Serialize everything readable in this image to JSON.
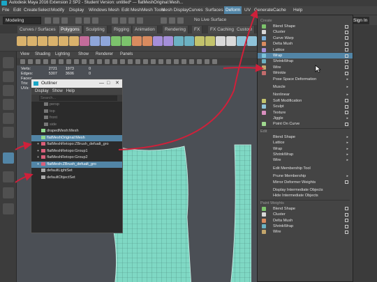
{
  "window": {
    "title": "Autodesk Maya 2016 Extension 2 SP2 - Student Version: untitled*   ---   flatMeshOriginal:Mesh..."
  },
  "menubar": [
    {
      "label": "File",
      "active": false
    },
    {
      "label": "Edit",
      "active": false
    },
    {
      "label": "Create",
      "active": false
    },
    {
      "label": "Select",
      "active": false
    },
    {
      "label": "Modify",
      "active": false
    },
    {
      "label": "Display",
      "active": false
    },
    {
      "label": "Windows",
      "active": false
    },
    {
      "label": "Mesh",
      "active": false
    },
    {
      "label": "Edit Mesh",
      "active": false
    },
    {
      "label": "Mesh Tools",
      "active": false
    },
    {
      "label": "Mesh Display",
      "active": false
    },
    {
      "label": "Curves",
      "active": false
    },
    {
      "label": "Surfaces",
      "active": false
    },
    {
      "label": "Deform",
      "active": true
    },
    {
      "label": "UV",
      "active": false
    },
    {
      "label": "Generate",
      "active": false
    },
    {
      "label": "Cache",
      "active": false
    },
    {
      "label": "Help",
      "active": false
    }
  ],
  "statusline": {
    "mode": "Modeling",
    "live_surface": "No Live Surface",
    "sign_in": "Sign In"
  },
  "shelf_tabs": [
    {
      "label": "Curves / Surfaces",
      "active": false
    },
    {
      "label": "Polygons",
      "active": true
    },
    {
      "label": "Sculpting",
      "active": false
    },
    {
      "label": "Rigging",
      "active": false
    },
    {
      "label": "Animation",
      "active": false
    },
    {
      "label": "Rendering",
      "active": false
    },
    {
      "label": "FX",
      "active": false
    },
    {
      "label": "FX Caching",
      "active": false
    },
    {
      "label": "Custom",
      "active": false
    }
  ],
  "viewport": {
    "menus": [
      "View",
      "Shading",
      "Lighting",
      "Show",
      "Renderer",
      "Panels"
    ],
    "hud": [
      {
        "label": "Verts:",
        "v1": "2721",
        "v2": "1973",
        "v3": "0"
      },
      {
        "label": "Edges:",
        "v1": "5307",
        "v2": "3606",
        "v3": "0"
      },
      {
        "label": "Faces:",
        "v1": "",
        "v2": "",
        "v3": ""
      },
      {
        "label": "Tris:",
        "v1": "",
        "v2": "",
        "v3": ""
      },
      {
        "label": "UVs:",
        "v1": "",
        "v2": "",
        "v3": ""
      }
    ]
  },
  "outliner": {
    "title": "Outliner",
    "menus": [
      "Display",
      "Show",
      "Help"
    ],
    "search_placeholder": "Search...",
    "items": [
      {
        "label": "persp",
        "state": "dim",
        "icon": "camera-icon",
        "expander": ""
      },
      {
        "label": "top",
        "state": "dim",
        "icon": "camera-icon",
        "expander": ""
      },
      {
        "label": "front",
        "state": "dim",
        "icon": "camera-icon",
        "expander": ""
      },
      {
        "label": "side",
        "state": "dim",
        "icon": "camera-icon",
        "expander": ""
      },
      {
        "label": "drapedMesh:Mesh",
        "state": "normal",
        "icon": "mesh-icon",
        "expander": ""
      },
      {
        "label": "flatMeshOriginal:Mesh",
        "state": "selected",
        "icon": "mesh-icon",
        "expander": ""
      },
      {
        "label": "flatMeshRetopo:ZBrush_defualt_gro",
        "state": "normal",
        "icon": "group-icon",
        "expander": "+"
      },
      {
        "label": "flatMeshRetopo:Group1",
        "state": "normal",
        "icon": "group-icon",
        "expander": "+"
      },
      {
        "label": "flatMeshRetopo:Group2",
        "state": "normal",
        "icon": "group-icon",
        "expander": "+"
      },
      {
        "label": "flatMesh:ZBrush_defualt_gro",
        "state": "selected",
        "icon": "group-icon",
        "expander": "+"
      },
      {
        "label": "defaultLightSet",
        "state": "normal",
        "icon": "set-icon",
        "expander": ""
      },
      {
        "label": "defaultObjectSet",
        "state": "normal",
        "icon": "set-icon",
        "expander": ""
      }
    ]
  },
  "deform_menu": {
    "sections": [
      {
        "title": "Create",
        "items": [
          {
            "label": "Blend Shape",
            "icon": "blend-shape-icon",
            "color": "#7cc36c",
            "trail": "opt",
            "hl": false
          },
          {
            "label": "Cluster",
            "icon": "cluster-icon",
            "color": "#d9d9d9",
            "trail": "opt",
            "hl": false
          },
          {
            "label": "Curve Warp",
            "icon": "curve-warp-icon",
            "color": "#7bb0d9",
            "trail": "opt",
            "hl": false
          },
          {
            "label": "Delta Mush",
            "icon": "delta-mush-icon",
            "color": "#d98b5f",
            "trail": "opt",
            "hl": false
          },
          {
            "label": "Lattice",
            "icon": "lattice-icon",
            "color": "#a58fd9",
            "trail": "opt",
            "hl": false
          },
          {
            "label": "Wrap",
            "icon": "wrap-icon",
            "color": "#7cc3d9",
            "trail": "opt",
            "hl": true
          },
          {
            "label": "ShrinkWrap",
            "icon": "shrinkwrap-icon",
            "color": "#6cb2c3",
            "trail": "opt",
            "hl": false
          },
          {
            "label": "Wire",
            "icon": "wire-icon",
            "color": "#c3a66c",
            "trail": "opt",
            "hl": false
          },
          {
            "label": "Wrinkle",
            "icon": "wrinkle-icon",
            "color": "#c36c6c",
            "trail": "opt",
            "hl": false
          },
          {
            "label": "Pose Space Deformation",
            "icon": "",
            "color": "",
            "trail": "sub",
            "hl": false
          },
          {
            "label": "Muscle",
            "icon": "",
            "color": "",
            "trail": "sub",
            "hl": false,
            "gap": true
          },
          {
            "label": "Nonlinear",
            "icon": "",
            "color": "",
            "trail": "sub",
            "hl": false,
            "gap": true
          },
          {
            "label": "Soft Modification",
            "icon": "soft-mod-icon",
            "color": "#c3c36c",
            "trail": "opt",
            "hl": false
          },
          {
            "label": "Sculpt",
            "icon": "sculpt-icon",
            "color": "#8fc3d9",
            "trail": "opt",
            "hl": false
          },
          {
            "label": "Texture",
            "icon": "texture-icon",
            "color": "#d98fbf",
            "trail": "opt",
            "hl": false
          },
          {
            "label": "Jiggle",
            "icon": "",
            "color": "",
            "trail": "sub",
            "hl": false
          },
          {
            "label": "Point On Curve",
            "icon": "point-on-curve-icon",
            "color": "#9fd98f",
            "trail": "opt",
            "hl": false
          }
        ]
      },
      {
        "title": "Edit",
        "items": [
          {
            "label": "Blend Shape",
            "icon": "",
            "color": "",
            "trail": "sub",
            "hl": false
          },
          {
            "label": "Lattice",
            "icon": "",
            "color": "",
            "trail": "sub",
            "hl": false
          },
          {
            "label": "Wrap",
            "icon": "",
            "color": "",
            "trail": "sub",
            "hl": false
          },
          {
            "label": "ShrinkWrap",
            "icon": "",
            "color": "",
            "trail": "sub",
            "hl": false
          },
          {
            "label": "Wire",
            "icon": "",
            "color": "",
            "trail": "sub",
            "hl": false
          },
          {
            "label": "Edit Membership Tool",
            "icon": "",
            "color": "",
            "trail": "",
            "hl": false,
            "gap": true
          },
          {
            "label": "Prune Membership",
            "icon": "",
            "color": "",
            "trail": "sub",
            "hl": false,
            "gap": true
          },
          {
            "label": "Mirror Deformer Weights",
            "icon": "",
            "color": "",
            "trail": "opt",
            "hl": false
          },
          {
            "label": "Display Intermediate Objects",
            "icon": "",
            "color": "",
            "trail": "",
            "hl": false,
            "gap": true
          },
          {
            "label": "Hide Intermediate Objects",
            "icon": "",
            "color": "",
            "trail": "",
            "hl": false
          }
        ]
      },
      {
        "title": "Paint Weights",
        "items": [
          {
            "label": "Blend Shape",
            "icon": "blend-shape-icon",
            "color": "#7cc36c",
            "trail": "opt",
            "hl": false
          },
          {
            "label": "Cluster",
            "icon": "cluster-icon",
            "color": "#d9d9d9",
            "trail": "opt",
            "hl": false
          },
          {
            "label": "Delta Mush",
            "icon": "delta-mush-icon",
            "color": "#d98b5f",
            "trail": "opt",
            "hl": false
          },
          {
            "label": "ShrinkWrap",
            "icon": "shrinkwrap-icon",
            "color": "#6cb2c3",
            "trail": "opt",
            "hl": false
          },
          {
            "label": "Wire",
            "icon": "wire-icon",
            "color": "#c3a66c",
            "trail": "opt",
            "hl": false
          }
        ]
      }
    ]
  },
  "colors": {
    "accent": "#5285a6",
    "mesh": "#7fd8c4",
    "arrow": "#d0203a"
  }
}
